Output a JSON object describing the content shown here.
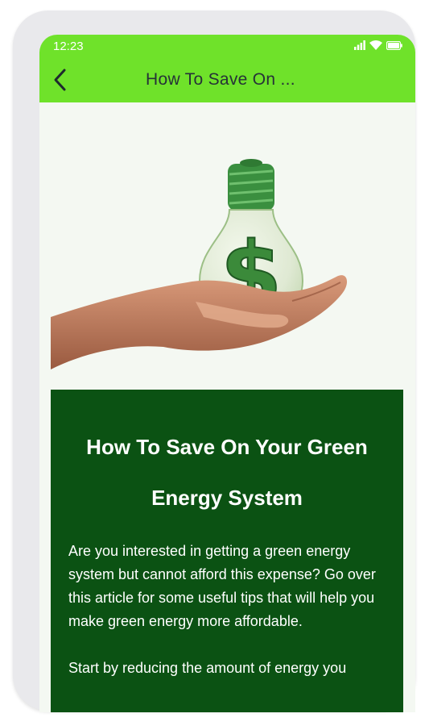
{
  "status_bar": {
    "time": "12:23"
  },
  "app_bar": {
    "title": "How To Save On ..."
  },
  "article": {
    "title": "How To Save On Your Green Energy System",
    "paragraphs": [
      "Are you interested in getting a green energy system but cannot afford this expense? Go over this article for some useful tips that will help you make green energy more affordable.",
      "Start by reducing the amount of energy you"
    ]
  },
  "icons": {
    "back": "arrow-back-icon",
    "signal": "signal-icon",
    "wifi": "wifi-icon",
    "battery": "battery-icon"
  },
  "colors": {
    "app_bar": "#6fe22a",
    "card": "#0b5213",
    "screen_bg": "#f4f8f2"
  }
}
